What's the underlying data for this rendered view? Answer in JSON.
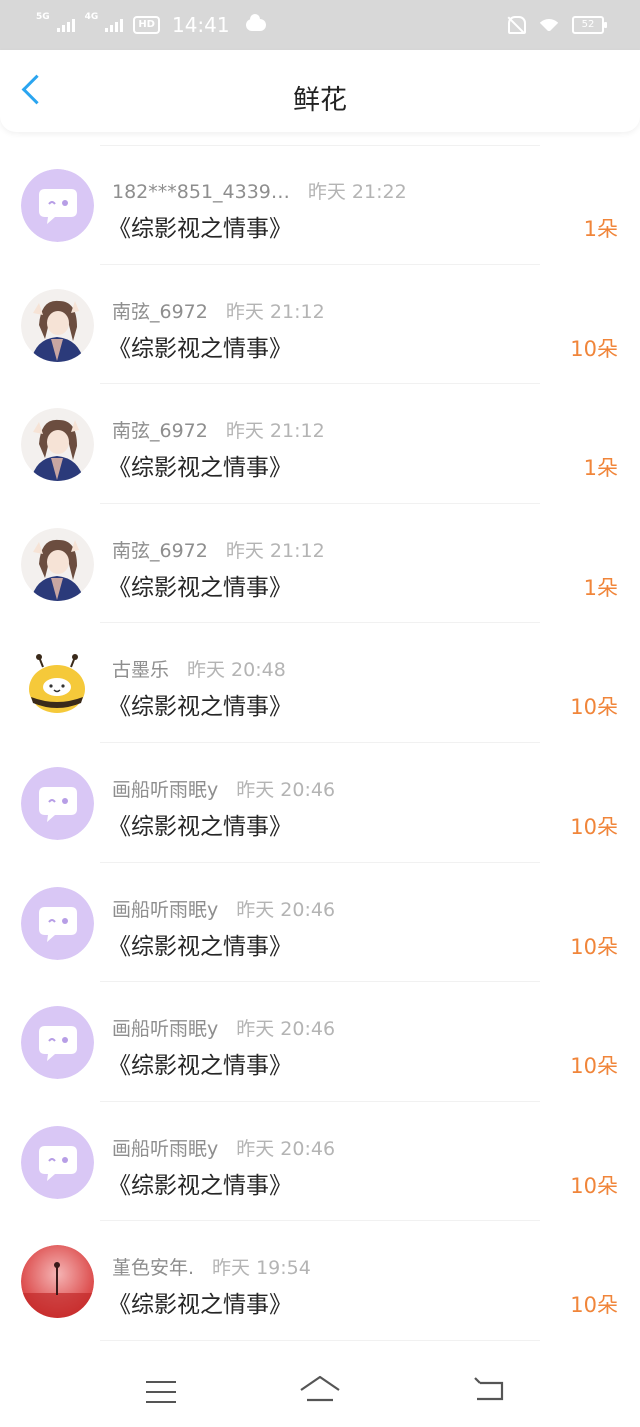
{
  "status_bar": {
    "network1": "5G",
    "network2": "4G",
    "hd": "HD",
    "time": "14:41",
    "battery": "52"
  },
  "header": {
    "title": "鲜花",
    "back_icon": "chevron-left-icon"
  },
  "accent_colors": {
    "back": "#2aa5f0",
    "count": "#f0853a"
  },
  "items": [
    {
      "user": "182***851_4339…",
      "time": "昨天 21:22",
      "book": "《综影视之情事》",
      "count": "1朵",
      "avatar": "default-chat-avatar"
    },
    {
      "user": "南弦_6972",
      "time": "昨天 21:12",
      "book": "《综影视之情事》",
      "count": "10朵",
      "avatar": "anime-girl-avatar"
    },
    {
      "user": "南弦_6972",
      "time": "昨天 21:12",
      "book": "《综影视之情事》",
      "count": "1朵",
      "avatar": "anime-girl-avatar"
    },
    {
      "user": "南弦_6972",
      "time": "昨天 21:12",
      "book": "《综影视之情事》",
      "count": "1朵",
      "avatar": "anime-girl-avatar"
    },
    {
      "user": "古墨乐",
      "time": "昨天 20:48",
      "book": "《综影视之情事》",
      "count": "10朵",
      "avatar": "bee-avatar"
    },
    {
      "user": "画船听雨眠y",
      "time": "昨天 20:46",
      "book": "《综影视之情事》",
      "count": "10朵",
      "avatar": "default-chat-avatar"
    },
    {
      "user": "画船听雨眠y",
      "time": "昨天 20:46",
      "book": "《综影视之情事》",
      "count": "10朵",
      "avatar": "default-chat-avatar"
    },
    {
      "user": "画船听雨眠y",
      "time": "昨天 20:46",
      "book": "《综影视之情事》",
      "count": "10朵",
      "avatar": "default-chat-avatar"
    },
    {
      "user": "画船听雨眠y",
      "time": "昨天 20:46",
      "book": "《综影视之情事》",
      "count": "10朵",
      "avatar": "default-chat-avatar"
    },
    {
      "user": "堇色安年.",
      "time": "昨天 19:54",
      "book": "《综影视之情事》",
      "count": "10朵",
      "avatar": "red-scene-avatar"
    }
  ],
  "nav": {
    "menu_icon": "menu-icon",
    "home_icon": "home-icon",
    "back_icon": "back-icon"
  }
}
